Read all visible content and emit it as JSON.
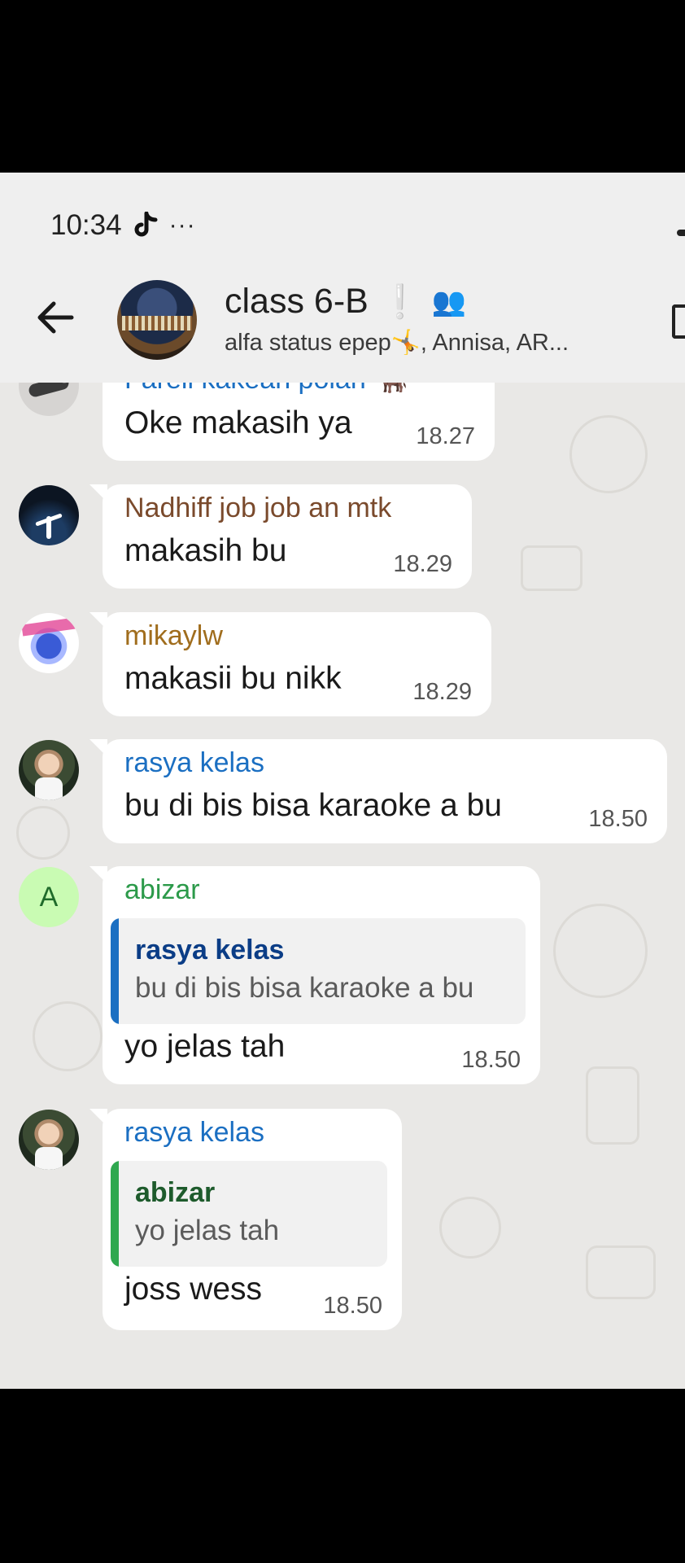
{
  "status_bar": {
    "time": "10:34",
    "overflow": "···"
  },
  "header": {
    "title": "class 6-B",
    "title_marks": "❕",
    "people_emoji": "👥",
    "subtitle": "alfa status epep🤸, Annisa, AR..."
  },
  "messages": [
    {
      "sender": "Farell kakean polah 🐂",
      "sender_color": "#1b6fc2",
      "text": "Oke makasih ya",
      "time": "18.27"
    },
    {
      "sender": "Nadhiff job job an mtk",
      "sender_color": "#7a4a2c",
      "text": "makasih bu",
      "time": "18.29"
    },
    {
      "sender": "mikaylw",
      "sender_color": "#a06d1d",
      "text": "makasii bu nikk",
      "time": "18.29"
    },
    {
      "sender": "rasya kelas",
      "sender_color": "#1b6fc2",
      "text": "bu di bis bisa karaoke a bu",
      "time": "18.50"
    },
    {
      "sender": "abizar",
      "sender_color": "#2c9a4a",
      "avatar_letter": "A",
      "quote": {
        "name": "rasya kelas",
        "text": "bu di bis bisa karaoke a bu",
        "color": "#0b3d86",
        "bar_color": "#1b6fc2"
      },
      "text": "yo jelas tah",
      "time": "18.50"
    },
    {
      "sender": "rasya kelas",
      "sender_color": "#1b6fc2",
      "quote": {
        "name": "abizar",
        "text": "yo jelas tah",
        "color": "#1e5b2c",
        "bar_color": "#2fa84f"
      },
      "text": "joss wess",
      "time": "18.50"
    }
  ]
}
